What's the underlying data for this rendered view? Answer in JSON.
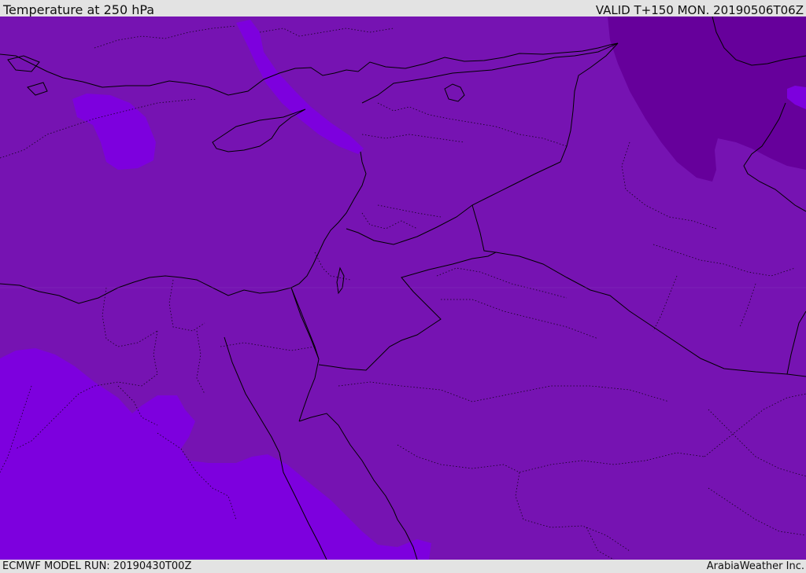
{
  "header": {
    "title": "Temperature at 250 hPa",
    "valid_time": "VALID T+150 MON. 20190506T06Z"
  },
  "footer": {
    "model_run": "ECMWF MODEL RUN: 20190430T00Z",
    "credit": "ArabiaWeather Inc."
  },
  "map": {
    "colors": {
      "base_fill": "#7613b2",
      "warm_fill": "#7d00de",
      "cold_fill": "#66009b",
      "coastline": "#000000",
      "borders": "#000000"
    }
  }
}
